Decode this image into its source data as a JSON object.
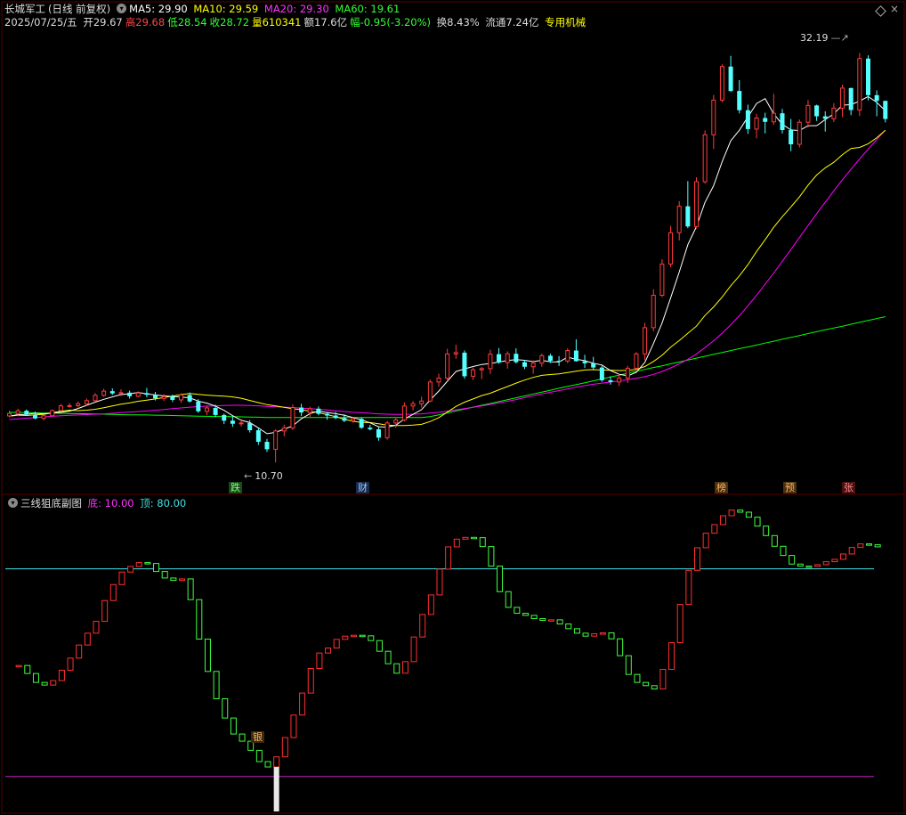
{
  "header": {
    "stock_name": "长城军工",
    "mode": "(日线 前复权)",
    "ma5_label": "MA5: 29.90",
    "ma10_label": "MA10: 29.59",
    "ma20_label": "MA20: 29.30",
    "ma60_label": "MA60: 19.61",
    "date": "2025/07/25/五",
    "open": "开29.67",
    "high": "高29.68",
    "low": "低28.54",
    "close": "收28.72",
    "volume": "量610341",
    "amount": "额17.6亿",
    "change": "幅-0.95(-3.20%)",
    "turnover": "换8.43%",
    "float": "流通7.24亿",
    "sector": "专用机械"
  },
  "sub_header": {
    "title": "三线狙底副图",
    "bottom_label": "底: 10.00",
    "top_label": "顶: 80.00"
  },
  "markers": {
    "m1": "跌",
    "m2": "财",
    "m3": "榜",
    "m4": "预",
    "m5": "张",
    "m6": "银"
  },
  "annotations": {
    "high_price": "32.19",
    "low_price": "10.70"
  },
  "colors": {
    "up": "#ff3b3b",
    "down": "#54ffff",
    "ma5": "#ffffff",
    "ma10": "#ffff00",
    "ma20": "#ff00ff",
    "ma60": "#00ff00",
    "osc_up": "#ff3030",
    "osc_down": "#40ff40",
    "level_top": "#40e0e0",
    "level_bottom": "#c020c0"
  },
  "chart_data": [
    {
      "type": "candlestick",
      "title": "长城军工 (日线 前复权)",
      "ylim": [
        10.1,
        33.0
      ],
      "candles": [
        [
          13.14,
          13.41,
          13.06,
          13.27
        ],
        [
          13.27,
          13.52,
          13.12,
          13.41
        ],
        [
          13.41,
          13.48,
          13.15,
          13.21
        ],
        [
          13.21,
          13.37,
          12.96,
          13.01
        ],
        [
          13.01,
          13.22,
          12.91,
          13.15
        ],
        [
          13.15,
          13.48,
          13.12,
          13.42
        ],
        [
          13.42,
          13.77,
          13.35,
          13.67
        ],
        [
          13.67,
          13.81,
          13.57,
          13.68
        ],
        [
          13.68,
          13.9,
          13.58,
          13.78
        ],
        [
          13.78,
          14.06,
          13.69,
          13.94
        ],
        [
          13.94,
          14.34,
          13.87,
          14.22
        ],
        [
          14.22,
          14.57,
          14.14,
          14.44
        ],
        [
          14.44,
          14.58,
          14.24,
          14.32
        ],
        [
          14.32,
          14.54,
          14.18,
          14.36
        ],
        [
          14.36,
          14.47,
          14.05,
          14.17
        ],
        [
          14.17,
          14.43,
          14.12,
          14.34
        ],
        [
          14.34,
          14.61,
          14.12,
          14.25
        ],
        [
          14.25,
          14.4,
          13.95,
          14.06
        ],
        [
          14.06,
          14.29,
          13.92,
          14.15
        ],
        [
          14.15,
          14.26,
          13.87,
          13.98
        ],
        [
          13.98,
          14.33,
          13.83,
          14.24
        ],
        [
          14.24,
          14.37,
          13.84,
          13.9
        ],
        [
          13.9,
          14.02,
          13.3,
          13.38
        ],
        [
          13.38,
          13.68,
          13.18,
          13.56
        ],
        [
          13.56,
          13.73,
          13.07,
          13.19
        ],
        [
          13.19,
          13.26,
          12.71,
          12.89
        ],
        [
          12.89,
          13.11,
          12.57,
          12.73
        ],
        [
          12.73,
          12.98,
          12.58,
          12.77
        ],
        [
          12.77,
          12.92,
          12.27,
          12.39
        ],
        [
          12.39,
          12.52,
          11.62,
          11.78
        ],
        [
          11.78,
          11.94,
          11.25,
          11.39
        ],
        [
          11.39,
          12.44,
          10.7,
          12.35
        ],
        [
          12.35,
          12.68,
          12.07,
          12.51
        ],
        [
          12.51,
          13.74,
          12.4,
          13.58
        ],
        [
          13.58,
          13.78,
          13.13,
          13.32
        ],
        [
          13.32,
          13.62,
          13.05,
          13.52
        ],
        [
          13.52,
          13.64,
          13.17,
          13.25
        ],
        [
          13.25,
          13.36,
          12.94,
          13.16
        ],
        [
          13.16,
          13.35,
          12.98,
          13.03
        ],
        [
          13.03,
          13.23,
          12.81,
          12.89
        ],
        [
          12.89,
          13.07,
          12.79,
          12.99
        ],
        [
          12.99,
          13.06,
          12.46,
          12.52
        ],
        [
          12.52,
          12.67,
          12.38,
          12.44
        ],
        [
          12.44,
          12.56,
          11.84,
          12.0
        ],
        [
          12.0,
          12.88,
          11.89,
          12.77
        ],
        [
          12.77,
          13.07,
          12.52,
          12.93
        ],
        [
          12.93,
          13.85,
          12.85,
          13.66
        ],
        [
          13.66,
          13.92,
          13.43,
          13.78
        ],
        [
          13.78,
          14.15,
          13.58,
          13.92
        ],
        [
          13.92,
          15.05,
          13.87,
          14.92
        ],
        [
          14.92,
          15.36,
          14.67,
          15.12
        ],
        [
          15.12,
          16.66,
          14.96,
          16.39
        ],
        [
          16.39,
          16.88,
          16.14,
          16.46
        ],
        [
          16.46,
          16.58,
          15.09,
          15.22
        ],
        [
          15.22,
          15.67,
          15.02,
          15.56
        ],
        [
          15.56,
          15.71,
          15.07,
          15.62
        ],
        [
          15.62,
          16.61,
          15.34,
          16.38
        ],
        [
          16.38,
          16.7,
          15.87,
          15.94
        ],
        [
          15.94,
          16.53,
          15.62,
          16.4
        ],
        [
          16.4,
          16.69,
          15.89,
          15.96
        ],
        [
          15.96,
          16.08,
          15.6,
          15.72
        ],
        [
          15.72,
          16.05,
          15.35,
          15.91
        ],
        [
          15.91,
          16.41,
          15.72,
          16.3
        ],
        [
          16.3,
          16.4,
          15.92,
          16.03
        ],
        [
          16.03,
          16.28,
          15.76,
          16.02
        ],
        [
          16.02,
          16.69,
          15.91,
          16.57
        ],
        [
          16.57,
          17.16,
          15.99,
          16.01
        ],
        [
          16.01,
          16.35,
          15.66,
          15.9
        ],
        [
          15.9,
          16.24,
          15.56,
          15.68
        ],
        [
          15.68,
          15.8,
          14.93,
          15.01
        ],
        [
          15.01,
          15.22,
          14.78,
          14.92
        ],
        [
          14.92,
          15.36,
          14.7,
          15.13
        ],
        [
          15.13,
          15.77,
          14.87,
          15.64
        ],
        [
          15.64,
          16.49,
          15.53,
          16.39
        ],
        [
          16.39,
          18.02,
          16.06,
          17.77
        ],
        [
          17.77,
          19.79,
          17.58,
          19.47
        ],
        [
          19.47,
          21.36,
          19.37,
          21.11
        ],
        [
          21.11,
          23.12,
          20.95,
          22.75
        ],
        [
          22.75,
          24.41,
          22.35,
          24.14
        ],
        [
          24.14,
          25.46,
          22.99,
          23.08
        ],
        [
          23.08,
          25.66,
          22.97,
          25.43
        ],
        [
          25.43,
          28.12,
          25.33,
          27.89
        ],
        [
          27.89,
          29.98,
          27.15,
          29.71
        ],
        [
          29.71,
          31.59,
          29.59,
          31.47
        ],
        [
          31.47,
          32.03,
          30.14,
          30.19
        ],
        [
          30.19,
          30.76,
          29.01,
          29.18
        ],
        [
          29.18,
          29.47,
          27.93,
          28.19
        ],
        [
          28.19,
          28.99,
          27.7,
          28.77
        ],
        [
          28.77,
          29.05,
          27.96,
          28.57
        ],
        [
          28.57,
          30.04,
          28.41,
          29.02
        ],
        [
          29.02,
          29.25,
          27.96,
          28.14
        ],
        [
          28.14,
          28.72,
          27.03,
          27.39
        ],
        [
          27.39,
          28.69,
          27.23,
          28.55
        ],
        [
          28.55,
          29.72,
          28.27,
          29.43
        ],
        [
          29.43,
          29.47,
          28.62,
          28.86
        ],
        [
          28.86,
          29.12,
          28.06,
          28.73
        ],
        [
          28.73,
          29.55,
          28.56,
          29.29
        ],
        [
          29.29,
          30.52,
          28.82,
          30.34
        ],
        [
          30.34,
          30.37,
          28.92,
          29.19
        ],
        [
          29.19,
          32.19,
          28.88,
          31.89
        ],
        [
          31.89,
          32.06,
          29.7,
          29.97
        ],
        [
          29.97,
          30.22,
          28.86,
          29.67
        ],
        [
          29.67,
          29.68,
          28.54,
          28.72
        ]
      ],
      "ma5": [
        13.13,
        13.21,
        13.22,
        13.28,
        13.25,
        13.29,
        13.33,
        13.39,
        13.53,
        13.7,
        13.86,
        14.01,
        14.14,
        14.26,
        14.3,
        14.37,
        14.29,
        14.24,
        14.19,
        14.16,
        14.13,
        14.09,
        13.92,
        13.81,
        13.65,
        13.43,
        13.15,
        12.91,
        12.79,
        12.51,
        12.21,
        12.28,
        12.44,
        12.62,
        12.99,
        13.26,
        13.4,
        13.31,
        13.26,
        13.17,
        13.06,
        12.93,
        12.78,
        12.57,
        12.55,
        12.65,
        12.98,
        13.22,
        13.47,
        13.98,
        14.44,
        14.96,
        15.47,
        15.61,
        15.73,
        15.84,
        15.89,
        15.97,
        16.05,
        16.09,
        16.06,
        15.99,
        16.06,
        15.98,
        15.97,
        16.22,
        16.11,
        16.04,
        15.9,
        15.81,
        15.52,
        15.33,
        15.24,
        15.43,
        15.95,
        16.94,
        18.01,
        19.34,
        20.69,
        22.13,
        23.07,
        24.34,
        25.22,
        26.49,
        27.58,
        28.13,
        28.83,
        29.53,
        29.79,
        28.99,
        28.44,
        28.15,
        28.11,
        28.37,
        28.37,
        28.69,
        28.99,
        29.45,
        29.47,
        29.66,
        29.9,
        29.59,
        29.15
      ],
      "ma10": [
        13.13,
        13.18,
        13.16,
        13.2,
        13.22,
        13.31,
        13.38,
        13.44,
        13.42,
        13.44,
        13.49,
        13.57,
        13.66,
        13.76,
        13.82,
        13.91,
        13.97,
        14.03,
        14.11,
        14.18,
        14.26,
        14.32,
        14.27,
        14.23,
        14.2,
        14.18,
        14.14,
        14.07,
        13.95,
        13.84,
        13.73,
        13.66,
        13.59,
        13.51,
        13.47,
        13.38,
        13.31,
        13.21,
        13.1,
        12.96,
        12.86,
        12.8,
        12.79,
        12.73,
        12.66,
        12.64,
        12.64,
        12.66,
        12.7,
        12.85,
        13.05,
        13.34,
        13.64,
        13.86,
        14.03,
        14.21,
        14.33,
        14.51,
        14.68,
        14.86,
        15.02,
        15.16,
        15.27,
        15.31,
        15.35,
        15.42,
        15.49,
        15.55,
        15.57,
        15.55,
        15.54,
        15.52,
        15.53,
        15.58,
        15.73,
        16.0,
        16.32,
        16.75,
        17.09,
        17.48,
        17.85,
        18.41,
        18.86,
        19.38,
        19.97,
        20.49,
        21.08,
        21.77,
        22.38,
        23.04,
        23.59,
        24.1,
        24.63,
        25.25,
        25.78,
        26.16,
        26.45,
        26.85,
        27.17,
        27.23,
        27.42,
        27.74,
        28.13
      ],
      "ma20": [
        12.95,
        12.99,
        13.02,
        13.05,
        13.09,
        13.12,
        13.15,
        13.17,
        13.19,
        13.21,
        13.23,
        13.25,
        13.28,
        13.31,
        13.34,
        13.37,
        13.4,
        13.44,
        13.48,
        13.52,
        13.56,
        13.6,
        13.63,
        13.65,
        13.67,
        13.69,
        13.7,
        13.7,
        13.69,
        13.67,
        13.64,
        13.62,
        13.6,
        13.58,
        13.55,
        13.52,
        13.49,
        13.45,
        13.41,
        13.37,
        13.33,
        13.31,
        13.28,
        13.25,
        13.23,
        13.22,
        13.22,
        13.23,
        13.25,
        13.29,
        13.33,
        13.39,
        13.46,
        13.52,
        13.59,
        13.66,
        13.74,
        13.82,
        13.91,
        14.0,
        14.1,
        14.2,
        14.29,
        14.38,
        14.47,
        14.56,
        14.65,
        14.73,
        14.8,
        14.86,
        14.92,
        14.98,
        15.04,
        15.11,
        15.2,
        15.32,
        15.47,
        15.66,
        15.87,
        16.11,
        16.39,
        16.72,
        17.08,
        17.48,
        17.92,
        18.4,
        18.92,
        19.47,
        20.05,
        20.64,
        21.25,
        21.87,
        22.5,
        23.13,
        23.75,
        24.36,
        24.95,
        25.53,
        26.09,
        26.62,
        27.14,
        27.65,
        28.13
      ],
      "ma60": [
        13.33,
        13.32,
        13.31,
        13.3,
        13.29,
        13.29,
        13.28,
        13.27,
        13.26,
        13.25,
        13.24,
        13.23,
        13.22,
        13.21,
        13.2,
        13.2,
        13.19,
        13.18,
        13.17,
        13.16,
        13.15,
        13.14,
        13.13,
        13.12,
        13.11,
        13.11,
        13.1,
        13.09,
        13.08,
        13.07,
        13.06,
        13.06,
        13.06,
        13.06,
        13.06,
        13.06,
        13.06,
        13.06,
        13.06,
        13.06,
        13.06,
        13.06,
        13.06,
        13.06,
        13.06,
        13.06,
        13.06,
        13.06,
        13.06,
        13.1,
        13.2,
        13.3,
        13.4,
        13.5,
        13.6,
        13.7,
        13.79,
        13.89,
        13.99,
        14.09,
        14.19,
        14.29,
        14.39,
        14.49,
        14.59,
        14.69,
        14.78,
        14.88,
        14.98,
        15.08,
        15.18,
        15.28,
        15.38,
        15.48,
        15.58,
        15.68,
        15.77,
        15.87,
        15.97,
        16.07,
        16.17,
        16.27,
        16.37,
        16.47,
        16.57,
        16.67,
        16.76,
        16.86,
        16.96,
        17.06,
        17.16,
        17.26,
        17.36,
        17.46,
        17.56,
        17.66,
        17.75,
        17.85,
        17.95,
        18.05,
        18.15,
        18.25,
        18.35
      ]
    },
    {
      "type": "bar",
      "title": "三线狙底副图",
      "ylim": [
        0,
        100
      ],
      "levels": {
        "bottom": 10,
        "top": 80
      },
      "values": [
        47.0,
        47.4,
        44.7,
        41.7,
        40.8,
        42.3,
        45.8,
        49.9,
        54.3,
        58.3,
        62.3,
        69.3,
        74.7,
        78.9,
        80.8,
        82.1,
        81.8,
        79.1,
        76.9,
        76.1,
        76.6,
        69.6,
        56.3,
        45.4,
        36.2,
        29.7,
        24.3,
        21.9,
        18.8,
        15.0,
        13.2,
        16.6,
        23.1,
        30.7,
        38.1,
        46.4,
        51.6,
        53.3,
        56.2,
        57.3,
        57.6,
        57.4,
        55.8,
        52.2,
        48.0,
        44.8,
        48.7,
        57.0,
        64.6,
        71.2,
        79.9,
        87.4,
        90.0,
        90.6,
        90.5,
        87.5,
        80.9,
        72.3,
        67.0,
        65.0,
        64.3,
        63.2,
        62.6,
        62.8,
        61.4,
        59.8,
        58.3,
        57.3,
        58.1,
        58.4,
        56.4,
        50.7,
        44.4,
        41.7,
        40.6,
        39.5,
        46.1,
        55.1,
        68.0,
        79.5,
        87.1,
        92.0,
        94.9,
        97.9,
        99.8,
        99.1,
        97.4,
        94.4,
        91.2,
        87.6,
        84.5,
        81.6,
        80.9,
        80.8,
        81.4,
        82.4,
        83.2,
        85.0,
        87.2,
        88.4,
        88.1,
        87.4
      ]
    }
  ]
}
